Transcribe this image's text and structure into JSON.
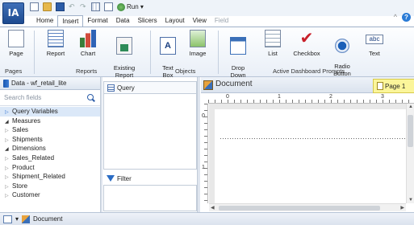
{
  "app": {
    "logo_text": "IA"
  },
  "quick_access": {
    "run_label": "Run ▾"
  },
  "menu_tabs": [
    {
      "label": "Home",
      "active": false
    },
    {
      "label": "Insert",
      "active": true
    },
    {
      "label": "Format",
      "active": false
    },
    {
      "label": "Data",
      "active": false
    },
    {
      "label": "Slicers",
      "active": false
    },
    {
      "label": "Layout",
      "active": false
    },
    {
      "label": "View",
      "active": false
    },
    {
      "label": "Field",
      "active": false,
      "disabled": true
    }
  ],
  "ribbon": {
    "buttons": {
      "page": "Page",
      "report": "Report",
      "chart": "Chart",
      "existing_report": "Existing\nReport",
      "text_box": "Text\nBox",
      "image": "Image",
      "drop_down": "Drop\nDown",
      "list": "List",
      "checkbox": "Checkbox",
      "radio_button": "Radio\nButton",
      "text": "Text",
      "text_icon": "abc"
    },
    "groups": {
      "pages": "Pages",
      "reports": "Reports",
      "objects": "Objects",
      "active_dashboard_prompts": "Active Dashboard Prompts"
    }
  },
  "data_panel": {
    "title": "Data - wf_retail_lite",
    "search_placeholder": "Search fields",
    "tree": [
      {
        "label": "Query Variables",
        "expanded": false,
        "selected": true
      },
      {
        "label": "Measures",
        "expanded": true
      },
      {
        "label": "Sales",
        "expanded": false
      },
      {
        "label": "Shipments",
        "expanded": false
      },
      {
        "label": "Dimensions",
        "expanded": true
      },
      {
        "label": "Sales_Related",
        "expanded": false
      },
      {
        "label": "Product",
        "expanded": false
      },
      {
        "label": "Shipment_Related",
        "expanded": false
      },
      {
        "label": "Store",
        "expanded": false
      },
      {
        "label": "Customer",
        "expanded": false
      }
    ]
  },
  "query_panel": {
    "title": "Query"
  },
  "filter_panel": {
    "title": "Filter"
  },
  "document": {
    "title": "Document",
    "page_tab": "Page 1",
    "ruler_h": [
      "0",
      "1",
      "2",
      "3"
    ],
    "ruler_v": [
      "0",
      "1"
    ]
  },
  "status_bar": {
    "document_label": "Document"
  },
  "colors": {
    "accent": "#2b5ca8",
    "page_tab_highlight": "#fbf59a",
    "selection": "#dbe8f8"
  }
}
